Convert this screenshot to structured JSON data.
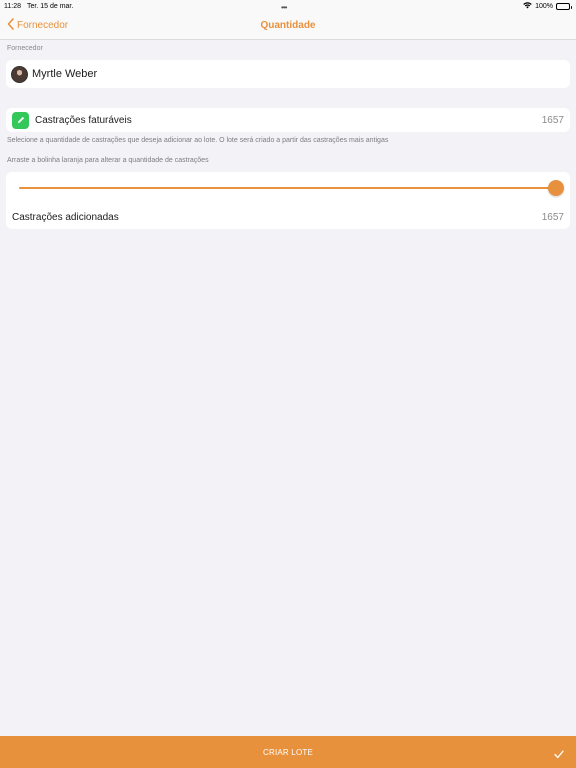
{
  "status_bar": {
    "time": "11:28",
    "date": "Ter. 15 de mar.",
    "battery": "100%",
    "multitask_dots": "•••"
  },
  "nav": {
    "back_label": "Fornecedor",
    "title": "Quantidade",
    "accent_color": "#e8913d"
  },
  "supplier": {
    "section_header": "Fornecedor",
    "name": "Myrtle Weber"
  },
  "billable": {
    "label": "Castrações faturáveis",
    "value": "1657",
    "icon": "pencil-icon",
    "icon_color": "#34c759"
  },
  "instructions": {
    "select_text": "Selecione a quantidade de castrações que deseja adicionar ao lote. O lote será criado a partir das castrações mais antigas",
    "drag_text": "Arraste a bolinha laranja para alterar a quantidade de castrações"
  },
  "slider": {
    "fraction": 1.0,
    "added_label": "Castrações adicionadas",
    "added_value": "1657"
  },
  "action": {
    "label": "CRIAR LOTE",
    "icon": "checkmark-icon"
  }
}
